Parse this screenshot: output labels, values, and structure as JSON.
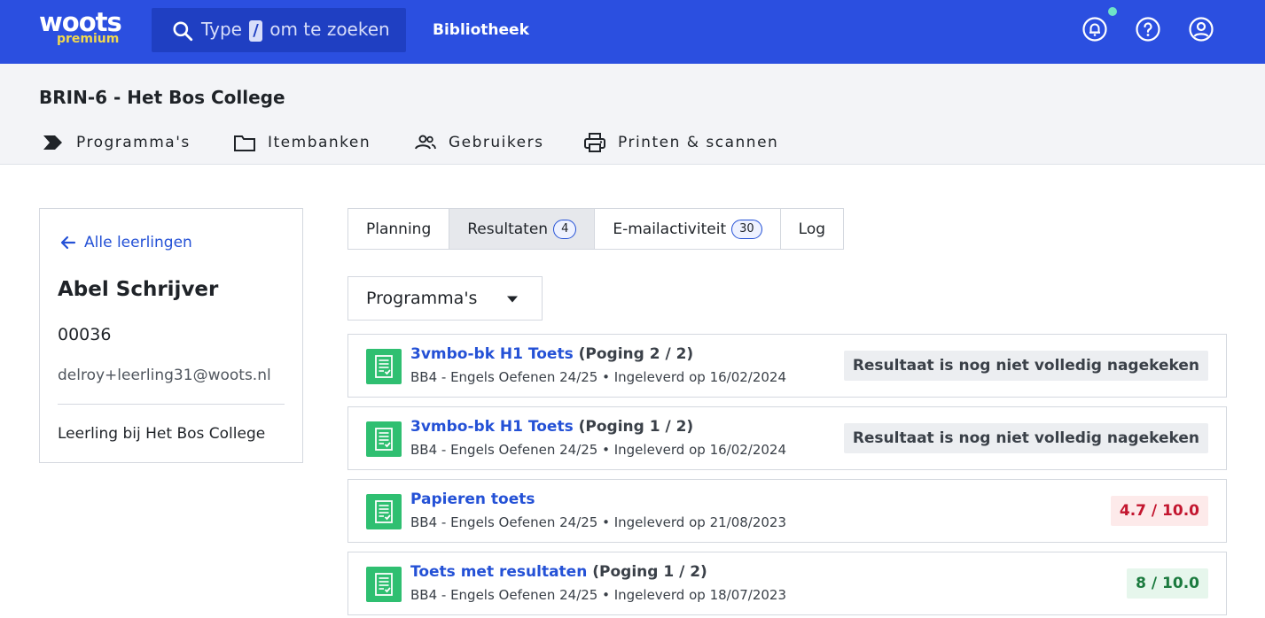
{
  "header": {
    "logo_main": "woots",
    "logo_sub": "premium",
    "search_prefix": "Type",
    "search_key": "/",
    "search_suffix": "om te zoeken",
    "library_link": "Bibliotheek",
    "icons": [
      "bell-icon",
      "help-icon",
      "account-icon"
    ]
  },
  "org": {
    "title": "BRIN-6 - Het Bos College",
    "nav": [
      {
        "label": "Programma's",
        "icon": "program-icon"
      },
      {
        "label": "Itembanken",
        "icon": "folder-icon"
      },
      {
        "label": "Gebruikers",
        "icon": "users-icon"
      },
      {
        "label": "Printen & scannen",
        "icon": "printer-icon"
      }
    ]
  },
  "student": {
    "back_label": "Alle leerlingen",
    "name": "Abel Schrijver",
    "id": "00036",
    "email": "delroy+leerling31@woots.nl",
    "role": "Leerling bij Het Bos College"
  },
  "tabs": [
    {
      "label": "Planning",
      "badge": ""
    },
    {
      "label": "Resultaten",
      "badge": "4"
    },
    {
      "label": "E-mailactiviteit",
      "badge": "30"
    },
    {
      "label": "Log",
      "badge": ""
    }
  ],
  "filter": {
    "label": "Programma's"
  },
  "results": [
    {
      "title": "3vmbo-bk H1 Toets",
      "attempt": "(Poging 2 / 2)",
      "subtitle": "BB4 - Engels Oefenen 24/25 • Ingeleverd op 16/02/2024",
      "status": "Resultaat is nog niet volledig nagekeken"
    },
    {
      "title": "3vmbo-bk H1 Toets",
      "attempt": "(Poging 1 / 2)",
      "subtitle": "BB4 - Engels Oefenen 24/25 • Ingeleverd op 16/02/2024",
      "status": "Resultaat is nog niet volledig nagekeken"
    },
    {
      "title": "Papieren toets",
      "attempt": "",
      "subtitle": "BB4 - Engels Oefenen 24/25 • Ingeleverd op 21/08/2023",
      "status": "4.7 / 10.0"
    },
    {
      "title": "Toets met resultaten",
      "attempt": "(Poging 1 / 2)",
      "subtitle": "BB4 - Engels Oefenen 24/25 • Ingeleverd op 18/07/2023",
      "status": "8 / 10.0"
    }
  ],
  "colors": {
    "brand": "#2b4fe0",
    "link": "#2451d6",
    "fail": "#c3162f",
    "pass": "#1b7a3e",
    "document_icon": "#2fbf71"
  }
}
